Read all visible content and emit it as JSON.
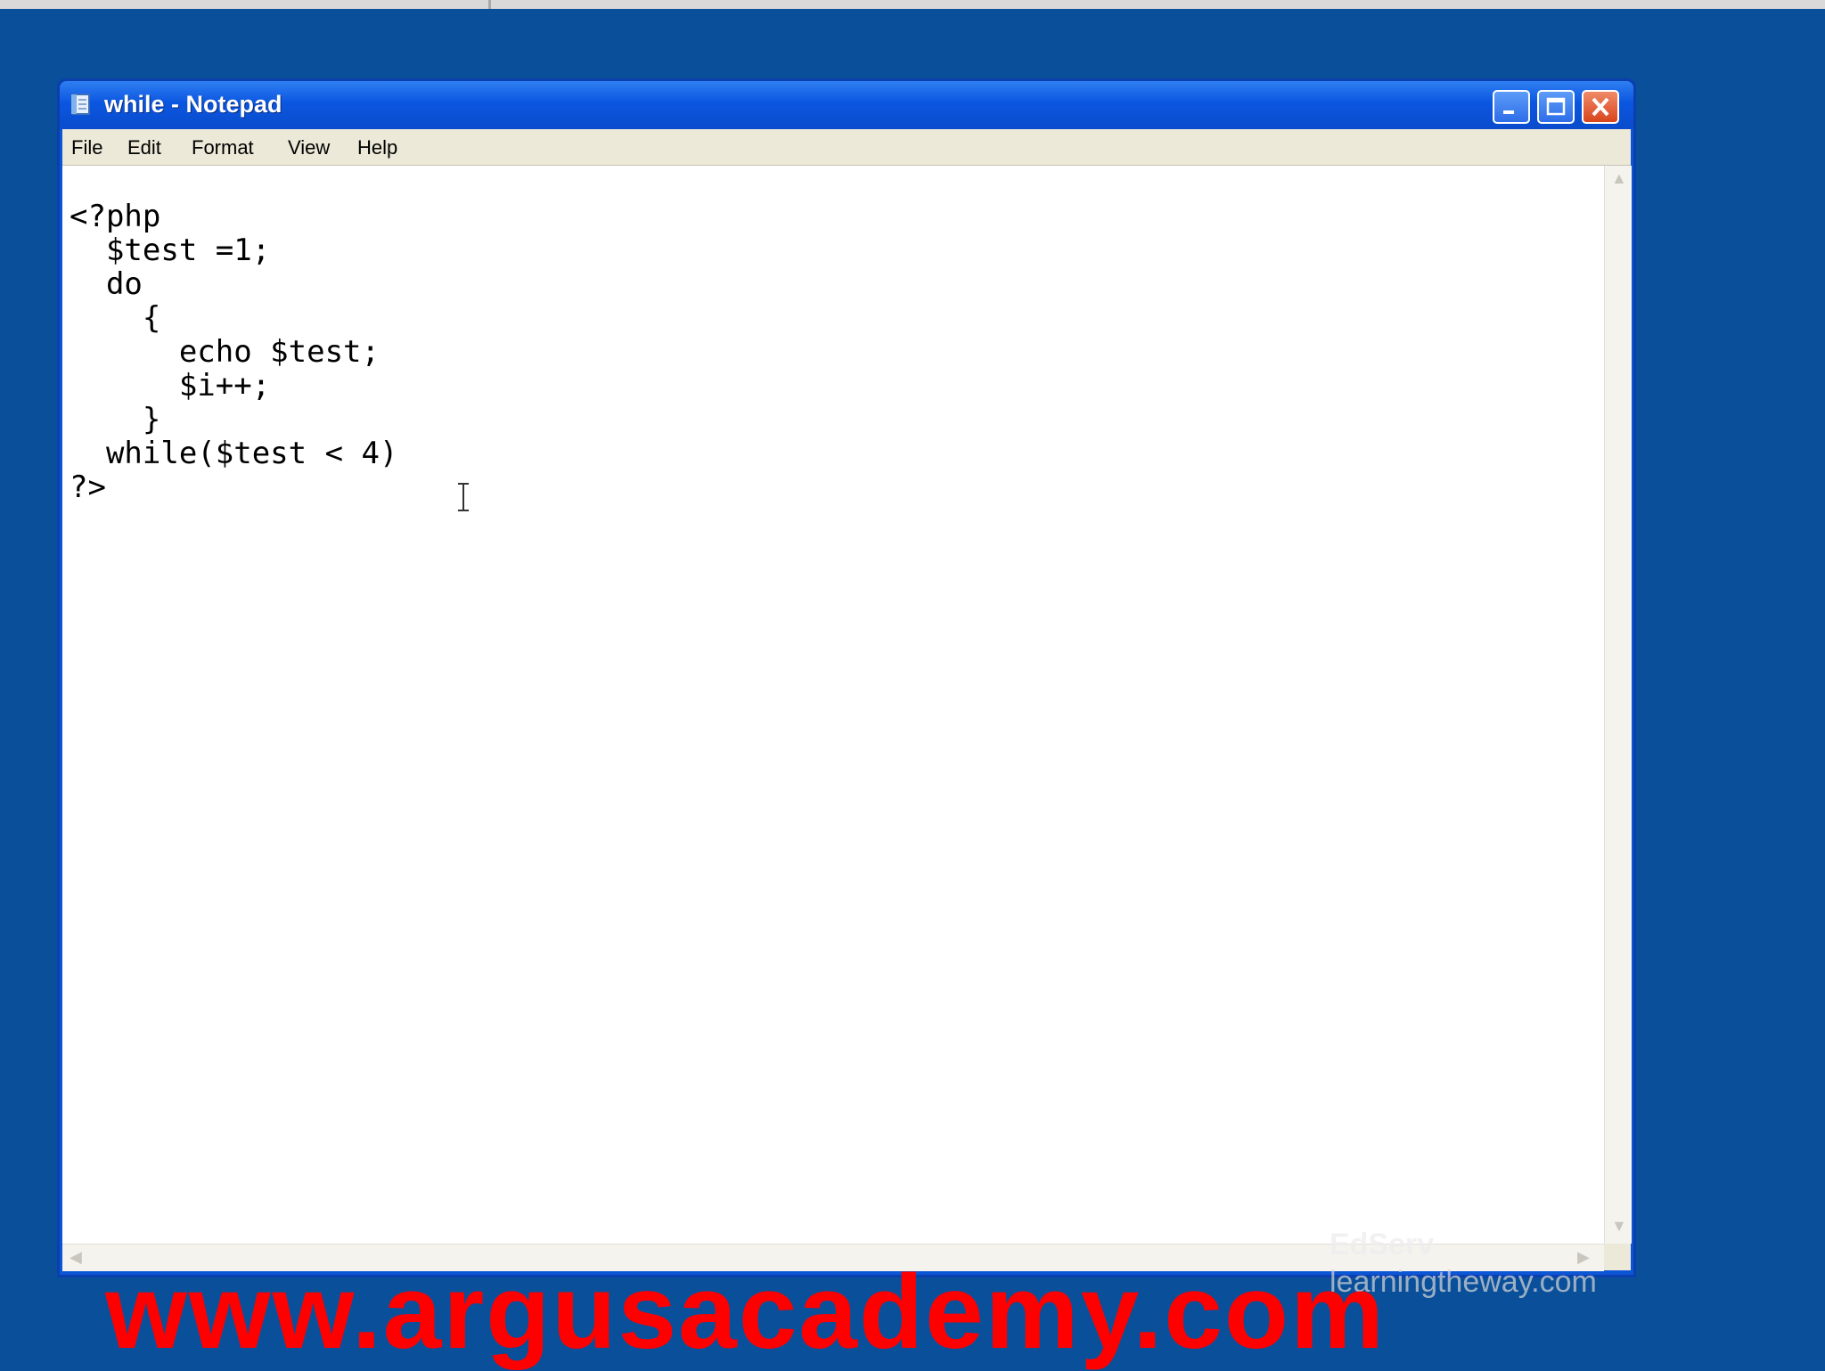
{
  "window": {
    "title": "while - Notepad"
  },
  "menubar": {
    "items": [
      "File",
      "Edit",
      "Format",
      "View",
      "Help"
    ]
  },
  "editor": {
    "code_lines": [
      "<?php",
      "  $test =1;",
      "  do",
      "    {",
      "      echo $test;",
      "      $i++;",
      "    }",
      "  while($test < 4)",
      "?>"
    ]
  },
  "watermark": {
    "logo_text": "EdServ",
    "site_text": "learningtheway.com",
    "banner_text": "www.argusacademy.com",
    "banner_color": "#ff0000"
  },
  "icons": {
    "app": "notepad-icon",
    "minimize": "minimize-icon",
    "maximize": "maximize-icon",
    "close": "close-icon",
    "text_cursor": "text-cursor-icon"
  }
}
